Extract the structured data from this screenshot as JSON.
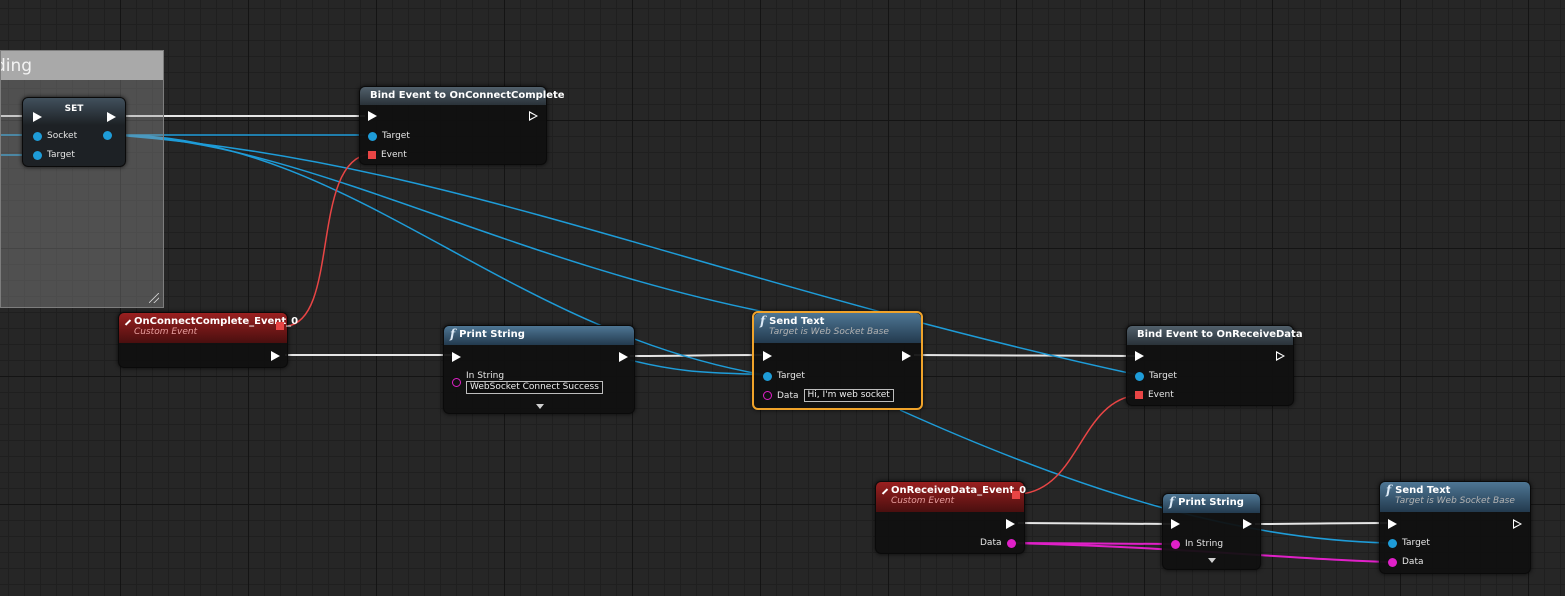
{
  "comment": {
    "title": "ding"
  },
  "set_node": {
    "title": "SET",
    "pins": {
      "socket": "Socket",
      "target": "Target"
    }
  },
  "bind_connect": {
    "title": "Bind Event to OnConnectComplete",
    "pins": {
      "target": "Target",
      "event": "Event"
    }
  },
  "on_connect_event": {
    "title": "OnConnectComplete_Event_0",
    "subtitle": "Custom Event"
  },
  "print_string_1": {
    "title": "Print String",
    "pins": {
      "in_string": "In String"
    },
    "in_string_value": "WebSocket Connect Success"
  },
  "send_text_1": {
    "title": "Send Text",
    "subtitle": "Target is Web Socket Base",
    "pins": {
      "target": "Target",
      "data": "Data"
    },
    "data_value": "Hi, I'm web socket"
  },
  "bind_receive": {
    "title": "Bind Event to OnReceiveData",
    "pins": {
      "target": "Target",
      "event": "Event"
    }
  },
  "on_receive_event": {
    "title": "OnReceiveData_Event_0",
    "subtitle": "Custom Event",
    "pins": {
      "data": "Data"
    }
  },
  "print_string_2": {
    "title": "Print String",
    "pins": {
      "in_string": "In String"
    }
  },
  "send_text_2": {
    "title": "Send Text",
    "subtitle": "Target is Web Socket Base",
    "pins": {
      "target": "Target",
      "data": "Data"
    }
  },
  "colors": {
    "exec_wire": "#e6e6e6",
    "object_wire": "#1e9cd8",
    "delegate_wire": "#e84545",
    "string_wire": "#e020c8",
    "selection": "#f0a32a",
    "event_header": "#9a2020",
    "function_header": "#4e7694"
  },
  "icons": {
    "function": "function-icon",
    "event": "event-diamond-icon",
    "bind": "bind-event-icon"
  }
}
